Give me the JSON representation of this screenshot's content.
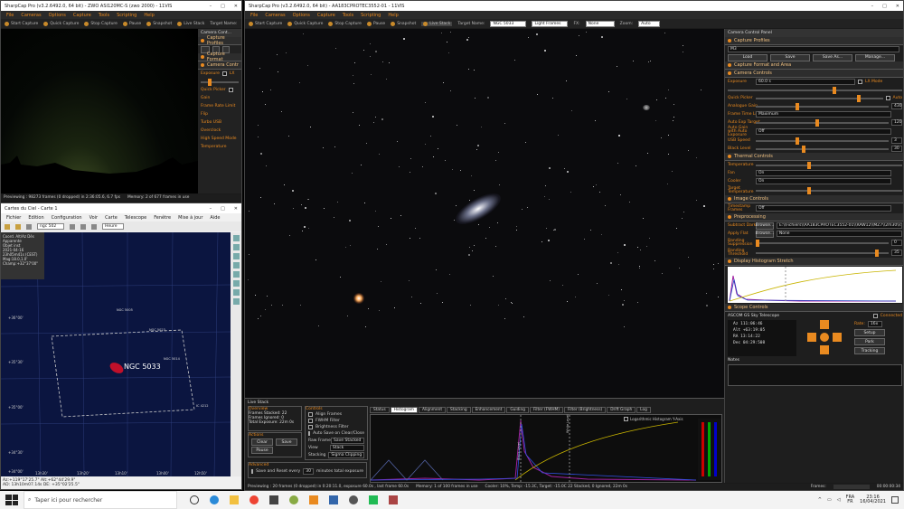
{
  "left_win": {
    "title": "SharpCap Pro (v3.2.6492.0, 64 bit) - ZWO ASI120MC-S (zwo 2000) - 11VIS",
    "menu": [
      "File",
      "Cameras",
      "Options",
      "Capture",
      "Tools",
      "Scripting",
      "Help"
    ],
    "toolbar": [
      "Start Capture",
      "Quick Capture",
      "Stop Capture",
      "Pause",
      "Snapshot",
      "Live Stack",
      "Target Name:"
    ],
    "panel_title": "Camera Cont...",
    "sections": [
      "Capture Profiles",
      "Capture Format",
      "Camera Contr"
    ],
    "rows": [
      "Exposure",
      "Quick Picker",
      "Gain",
      "Frame Rate Limit",
      "Flip",
      "Turbo USB",
      "Overclock",
      "High Speed Mode",
      "Temperature"
    ],
    "exposure_value": "LX",
    "status": "Previewing : 98273 frames (0 dropped) in 2:36:05.6, 6.7 fps",
    "memory": "Memory: 2 of 677 frames in use"
  },
  "cdc": {
    "title": "Cartes du Ciel - Carte 1",
    "menu": [
      "Fichier",
      "Edition",
      "Configuration",
      "Voir",
      "Carte",
      "Telescope",
      "Fenêtre",
      "Mise à jour",
      "Aide"
    ],
    "search": "ngc 502",
    "fov": "Heure",
    "info": [
      "Coord. Alt/Az Dés",
      "Apparente",
      "Objet inst",
      "2021-04-16",
      "23h05m41s (CEST)",
      "Mag:18.0,1.0'",
      "Champ:+32°37'00\""
    ],
    "dec_labels": [
      "+36°00'",
      "+35°30'",
      "+35°00'",
      "+34°30'",
      "+34°00'"
    ],
    "ra_labels": [
      "13h30'",
      "13h20'",
      "13h10'",
      "13h00'",
      "12h50'"
    ],
    "objects": [
      {
        "name": "NGC 5033",
        "big": true
      },
      {
        "name": "NGC 5005"
      },
      {
        "name": "NGC 5023"
      },
      {
        "name": "NGC 5014"
      },
      {
        "name": "IC 4212"
      }
    ],
    "status": [
      "Az:+119°17'25.7\" Alt:+62°44'29.9\"",
      "AD: 13h10m07.14s DE: +35°02'25.5\""
    ]
  },
  "main_win": {
    "title": "SharpCap Pro (v3.2.6492.0, 64 bit) - AA183CPROTEC3552-01 - 11VIS",
    "menu": [
      "File",
      "Cameras",
      "Options",
      "Capture",
      "Tools",
      "Scripting",
      "Help"
    ],
    "toolbar": [
      "Start Capture",
      "Quick Capture",
      "Stop Capture",
      "Pause",
      "Snapshot",
      "Live Stack",
      "Target Name:"
    ],
    "target": "NGC 5033",
    "frame_type": "Light Frames",
    "fx": "FX:",
    "fx_value": "None",
    "zoom_label": "Zoom:",
    "zoom_value": "Auto"
  },
  "ccp": {
    "title": "Camera Control Panel",
    "capture_profiles": "Capture Profiles",
    "profile": "M3",
    "profile_btns": [
      "Load",
      "Save",
      "Save As...",
      "Manage..."
    ],
    "capture_format": "Capture Format and Area",
    "camera_controls": "Camera Controls",
    "exposure": {
      "label": "Exposure",
      "value": "60.0 s",
      "lx": "LX Mode"
    },
    "quick_picker": "Quick Picker",
    "auto": "Auto",
    "analogue_gain": {
      "label": "Analogue Gain",
      "value": "430"
    },
    "frame_time_limit": {
      "label": "Frame Time Limit",
      "value": "Maximum"
    },
    "auto_exp_target": {
      "label": "Auto Exp Target",
      "value": "120"
    },
    "auto_gain": {
      "label": "Auto Gain with Auto Exposure",
      "value": "Off"
    },
    "usb_speed": {
      "label": "USB Speed",
      "value": "3"
    },
    "black_level": {
      "label": "Black Level",
      "value": "30"
    },
    "thermal": "Thermal Controls",
    "temperature": {
      "label": "Temperature"
    },
    "fan": {
      "label": "Fan",
      "value": "On"
    },
    "cooler": {
      "label": "Cooler",
      "value": "On"
    },
    "target_temp": {
      "label": "Target Temperature"
    },
    "image_controls": "Image Controls",
    "timestamp": {
      "label": "Timestamp Frames",
      "value": "Off"
    },
    "preprocessing": "Preprocessing",
    "subtract_dark": {
      "label": "Subtract Dark",
      "btn": "Browse...",
      "value": "E:\\\\Fichiers\\\\AA183CPROTEC3552-01\\\\RAW12\\\\MZ7\\\\2m30\\\\dark-60s..."
    },
    "apply_flat": {
      "label": "Apply Flat",
      "btn": "Browse...",
      "value": "None"
    },
    "banding_supp": {
      "label": "Banding Suppression",
      "value": "0"
    },
    "banding_thresh": {
      "label": "Banding Threshold",
      "value": "35"
    },
    "histogram": "Display Histogram Stretch",
    "scope": "Scope Controls",
    "scope_name": "ASCOM GS Sky Telescope",
    "connected": "Connected",
    "coords": [
      "Az   111:06:46",
      "Alt  +63:19:05",
      "RA   13:14:22",
      "Dec  04:29:508"
    ],
    "rate": "Rate:",
    "rate_value": "16x",
    "setup": "Setup",
    "park": "Park",
    "tracking": "Tracking",
    "notes": "Notes"
  },
  "live_stack": {
    "title": "Live Stack",
    "overview": "Overview",
    "frames_stacked": "Frames Stacked: 22",
    "frames_ignored": "Frames Ignored: 0",
    "total_exposure": "Total Exposure: 22m 0s",
    "actions": "Actions",
    "clear": "Clear",
    "save": "Save",
    "pause": "Pause",
    "advanced": "Advanced",
    "save_reset": "Save and Reset every",
    "minutes": "minutes total exposure",
    "save_reset_value": "30",
    "controls": "Controls",
    "align": "Align Frames",
    "fwhm": "FWHM Filter",
    "brightness": "Brightness Filter",
    "autosave": "Auto Save on Clear/Close",
    "raw_frames": "Raw Frames",
    "raw_value": "Save Stacked",
    "view": "View",
    "view_value": "Stack",
    "stacking": "Stacking",
    "stacking_value": "Sigma Clipping",
    "tabs": [
      "Status",
      "Histogram",
      "Alignment",
      "Stacking",
      "Enhancement",
      "Guiding",
      "Filter (FWHM)",
      "Filter (Brightness)",
      "Drift Graph",
      "Log"
    ],
    "active_tab": "Histogram",
    "log_hist": "Logarithmic Histogram Y-Axis",
    "black_level": "Black Level",
    "white_level": "White Level"
  },
  "main_status": {
    "preview": "Previewing : 20 frames (0 dropped) in 0:20:11.0, exposure 60.0s , last frame 60.0s",
    "memory": "Memory: 1 of 100 frames in use",
    "cooler": "Cooler: 10%, Temp: -15.3C, Target: -15.0C 22 Stacked, 0 Ignored, 22m 0s",
    "frames_label": "Frames:",
    "time": "00:00:00:34"
  },
  "taskbar": {
    "search": "Taper ici pour rechercher",
    "lang": "FRA",
    "layout": "FR",
    "time": "23:16",
    "date": "16/04/2021"
  },
  "colors": {
    "accent": "#e98a20",
    "bg": "#1a1a1a"
  }
}
